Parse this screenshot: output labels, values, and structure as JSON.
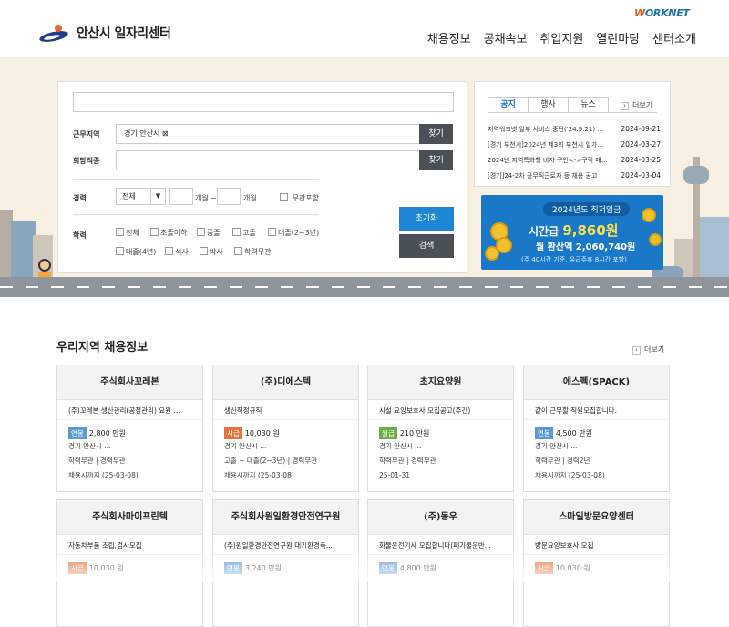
{
  "header": {
    "logo": "안산시 일자리센터",
    "worknet_a": "W",
    "worknet_b": "ORKNET",
    "nav": [
      "채용정보",
      "공채속보",
      "취업지원",
      "열린마당",
      "센터소개"
    ]
  },
  "search": {
    "keyword_value": "",
    "region_label": "근무지역",
    "region_value": "경기 안산시 ⊠",
    "find_label": "찾기",
    "job_label": "희망직종",
    "career_label": "경력",
    "career_select": "전체",
    "career_from_unit": "개월 ~",
    "career_to_unit": "개월",
    "career_none": "무관포함",
    "edu_label": "학력",
    "edu_options": [
      "전체",
      "초졸이하",
      "중졸",
      "고졸",
      "대졸(2~3년)",
      "대졸(4년)",
      "석사",
      "박사",
      "학력무관"
    ],
    "reset_label": "초기화",
    "search_label": "검색"
  },
  "notice": {
    "tabs": [
      "공지",
      "행사",
      "뉴스"
    ],
    "more": "더보기",
    "items": [
      {
        "title": "지역워크넷 일부 서비스 중단('24.9.21) 안내",
        "date": "2024-09-21"
      },
      {
        "title": "[경기 부천시]2024년 제3회 부천시 일가정 양립",
        "date": "2024-03-27"
      },
      {
        "title": "2024년 지역특화형 비자 구인<->구직 매칭 지원",
        "date": "2024-03-25"
      },
      {
        "title": "[경기]24-2차 공무직근로자 등 채용 공고",
        "date": "2024-03-04"
      }
    ]
  },
  "banner": {
    "year": "2024년도 최저임금",
    "hourly_label": "시간급",
    "hourly_value": "9,860원",
    "monthly": "월 환산액 2,060,740원",
    "note": "(주 40시간 기준, 유급주휴 8시간 포함)"
  },
  "jobs": {
    "title": "우리지역 채용정보",
    "more": "더보기",
    "cards": [
      {
        "company": "주식회사꼬레본",
        "job": "(주)꼬레본 생산관리(공정관리) 요원 ...",
        "pay_type": "연봉",
        "pay_class": "y",
        "pay": "2,800 만원",
        "region": "경기 안산시 ...",
        "edu": "학력무관 | 경력무관",
        "deadline": "채용시까지 (25-03-08)"
      },
      {
        "company": "(주)디에스텍",
        "job": "생산직정규직",
        "pay_type": "시급",
        "pay_class": "h",
        "pay": "10,030 원",
        "region": "경기 안산시 ...",
        "edu": "고졸 ~ 대졸(2~3년) | 경력무관",
        "deadline": "채용시까지 (25-03-08)"
      },
      {
        "company": "초지요양원",
        "job": "시설 요양보호사 모집공고(주간)",
        "pay_type": "월급",
        "pay_class": "m",
        "pay": "210 만원",
        "region": "경기 안산시 ...",
        "edu": "학력무관 | 경력무관",
        "deadline": "25-01-31"
      },
      {
        "company": "에스펙(SPACK)",
        "job": "같이 근무할 직원모집합니다.",
        "pay_type": "연봉",
        "pay_class": "y",
        "pay": "4,500 만원",
        "region": "경기 안산시 ...",
        "edu": "학력무관 | 경력2년",
        "deadline": "채용시까지 (25-03-08)"
      },
      {
        "company": "주식회사마이프린텍",
        "job": "자동차부품 조립,검사모집",
        "pay_type": "시급",
        "pay_class": "h",
        "pay": "10,030 원",
        "region": "",
        "edu": "",
        "deadline": ""
      },
      {
        "company": "주식회사원일환경안전연구원",
        "job": "(주)원일환경안전연구원 대기환경측...",
        "pay_type": "연봉",
        "pay_class": "y",
        "pay": "3,240 만원",
        "region": "",
        "edu": "",
        "deadline": ""
      },
      {
        "company": "(주)동우",
        "job": "화물운전기사 모집합니다(폐기물운반...",
        "pay_type": "연봉",
        "pay_class": "y",
        "pay": "4,800 만원",
        "region": "",
        "edu": "",
        "deadline": ""
      },
      {
        "company": "스마일방문요양센터",
        "job": "방문요양보호사 모집",
        "pay_type": "시급",
        "pay_class": "h",
        "pay": "10,030 원",
        "region": "",
        "edu": "",
        "deadline": ""
      }
    ]
  }
}
